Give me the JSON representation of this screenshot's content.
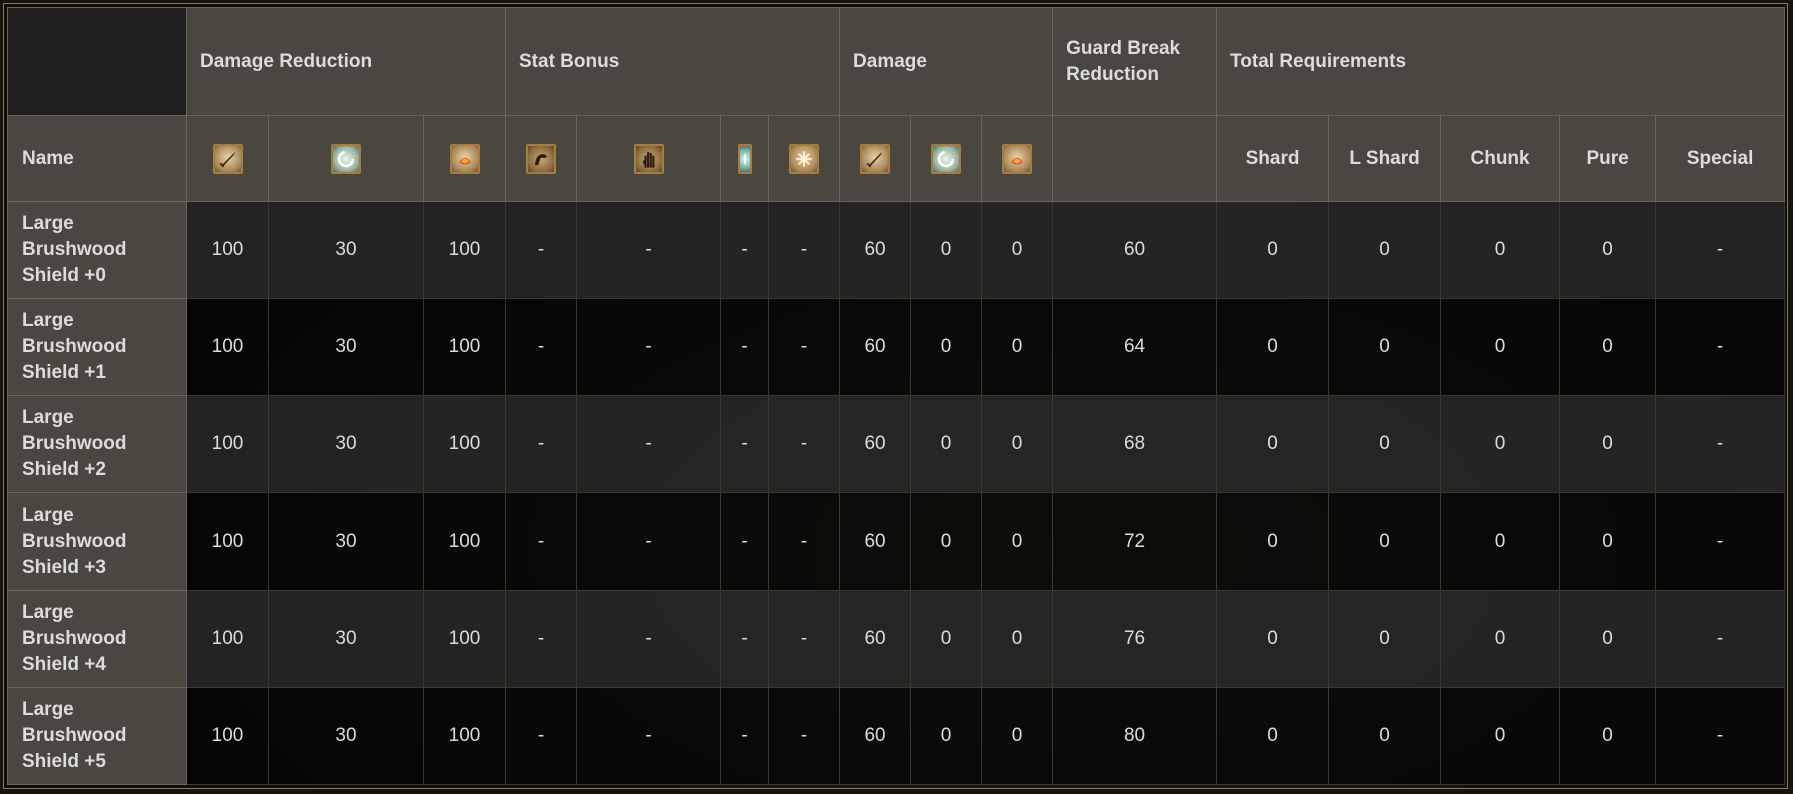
{
  "group_headers": {
    "damage_reduction": "Damage Reduction",
    "stat_bonus": "Stat Bonus",
    "damage": "Damage",
    "guard_break": "Guard Break Reduction",
    "total_requirements": "Total Requirements"
  },
  "sub_headers": {
    "name": "Name",
    "dr_icons": [
      "physical-icon",
      "magic-icon",
      "fire-icon"
    ],
    "stat_icons": [
      "strength-icon",
      "dexterity-icon",
      "faith-icon",
      "intelligence-icon"
    ],
    "dmg_icons": [
      "physical-icon",
      "magic-icon",
      "fire-icon"
    ],
    "shard": "Shard",
    "l_shard": "L Shard",
    "chunk": "Chunk",
    "pure": "Pure",
    "special": "Special"
  },
  "rows": [
    {
      "name": "Large Brushwood Shield +0",
      "dr_phys": "100",
      "dr_mag": "30",
      "dr_fire": "100",
      "str": "-",
      "dex": "-",
      "fth": "-",
      "int": "-",
      "dmg_phys": "60",
      "dmg_mag": "0",
      "dmg_fire": "0",
      "gbr": "60",
      "shard": "0",
      "l_shard": "0",
      "chunk": "0",
      "pure": "0",
      "special": "-"
    },
    {
      "name": "Large Brushwood Shield +1",
      "dr_phys": "100",
      "dr_mag": "30",
      "dr_fire": "100",
      "str": "-",
      "dex": "-",
      "fth": "-",
      "int": "-",
      "dmg_phys": "60",
      "dmg_mag": "0",
      "dmg_fire": "0",
      "gbr": "64",
      "shard": "0",
      "l_shard": "0",
      "chunk": "0",
      "pure": "0",
      "special": "-"
    },
    {
      "name": "Large Brushwood Shield +2",
      "dr_phys": "100",
      "dr_mag": "30",
      "dr_fire": "100",
      "str": "-",
      "dex": "-",
      "fth": "-",
      "int": "-",
      "dmg_phys": "60",
      "dmg_mag": "0",
      "dmg_fire": "0",
      "gbr": "68",
      "shard": "0",
      "l_shard": "0",
      "chunk": "0",
      "pure": "0",
      "special": "-"
    },
    {
      "name": "Large Brushwood Shield +3",
      "dr_phys": "100",
      "dr_mag": "30",
      "dr_fire": "100",
      "str": "-",
      "dex": "-",
      "fth": "-",
      "int": "-",
      "dmg_phys": "60",
      "dmg_mag": "0",
      "dmg_fire": "0",
      "gbr": "72",
      "shard": "0",
      "l_shard": "0",
      "chunk": "0",
      "pure": "0",
      "special": "-"
    },
    {
      "name": "Large Brushwood Shield +4",
      "dr_phys": "100",
      "dr_mag": "30",
      "dr_fire": "100",
      "str": "-",
      "dex": "-",
      "fth": "-",
      "int": "-",
      "dmg_phys": "60",
      "dmg_mag": "0",
      "dmg_fire": "0",
      "gbr": "76",
      "shard": "0",
      "l_shard": "0",
      "chunk": "0",
      "pure": "0",
      "special": "-"
    },
    {
      "name": "Large Brushwood Shield +5",
      "dr_phys": "100",
      "dr_mag": "30",
      "dr_fire": "100",
      "str": "-",
      "dex": "-",
      "fth": "-",
      "int": "-",
      "dmg_phys": "60",
      "dmg_mag": "0",
      "dmg_fire": "0",
      "gbr": "80",
      "shard": "0",
      "l_shard": "0",
      "chunk": "0",
      "pure": "0",
      "special": "-"
    }
  ]
}
